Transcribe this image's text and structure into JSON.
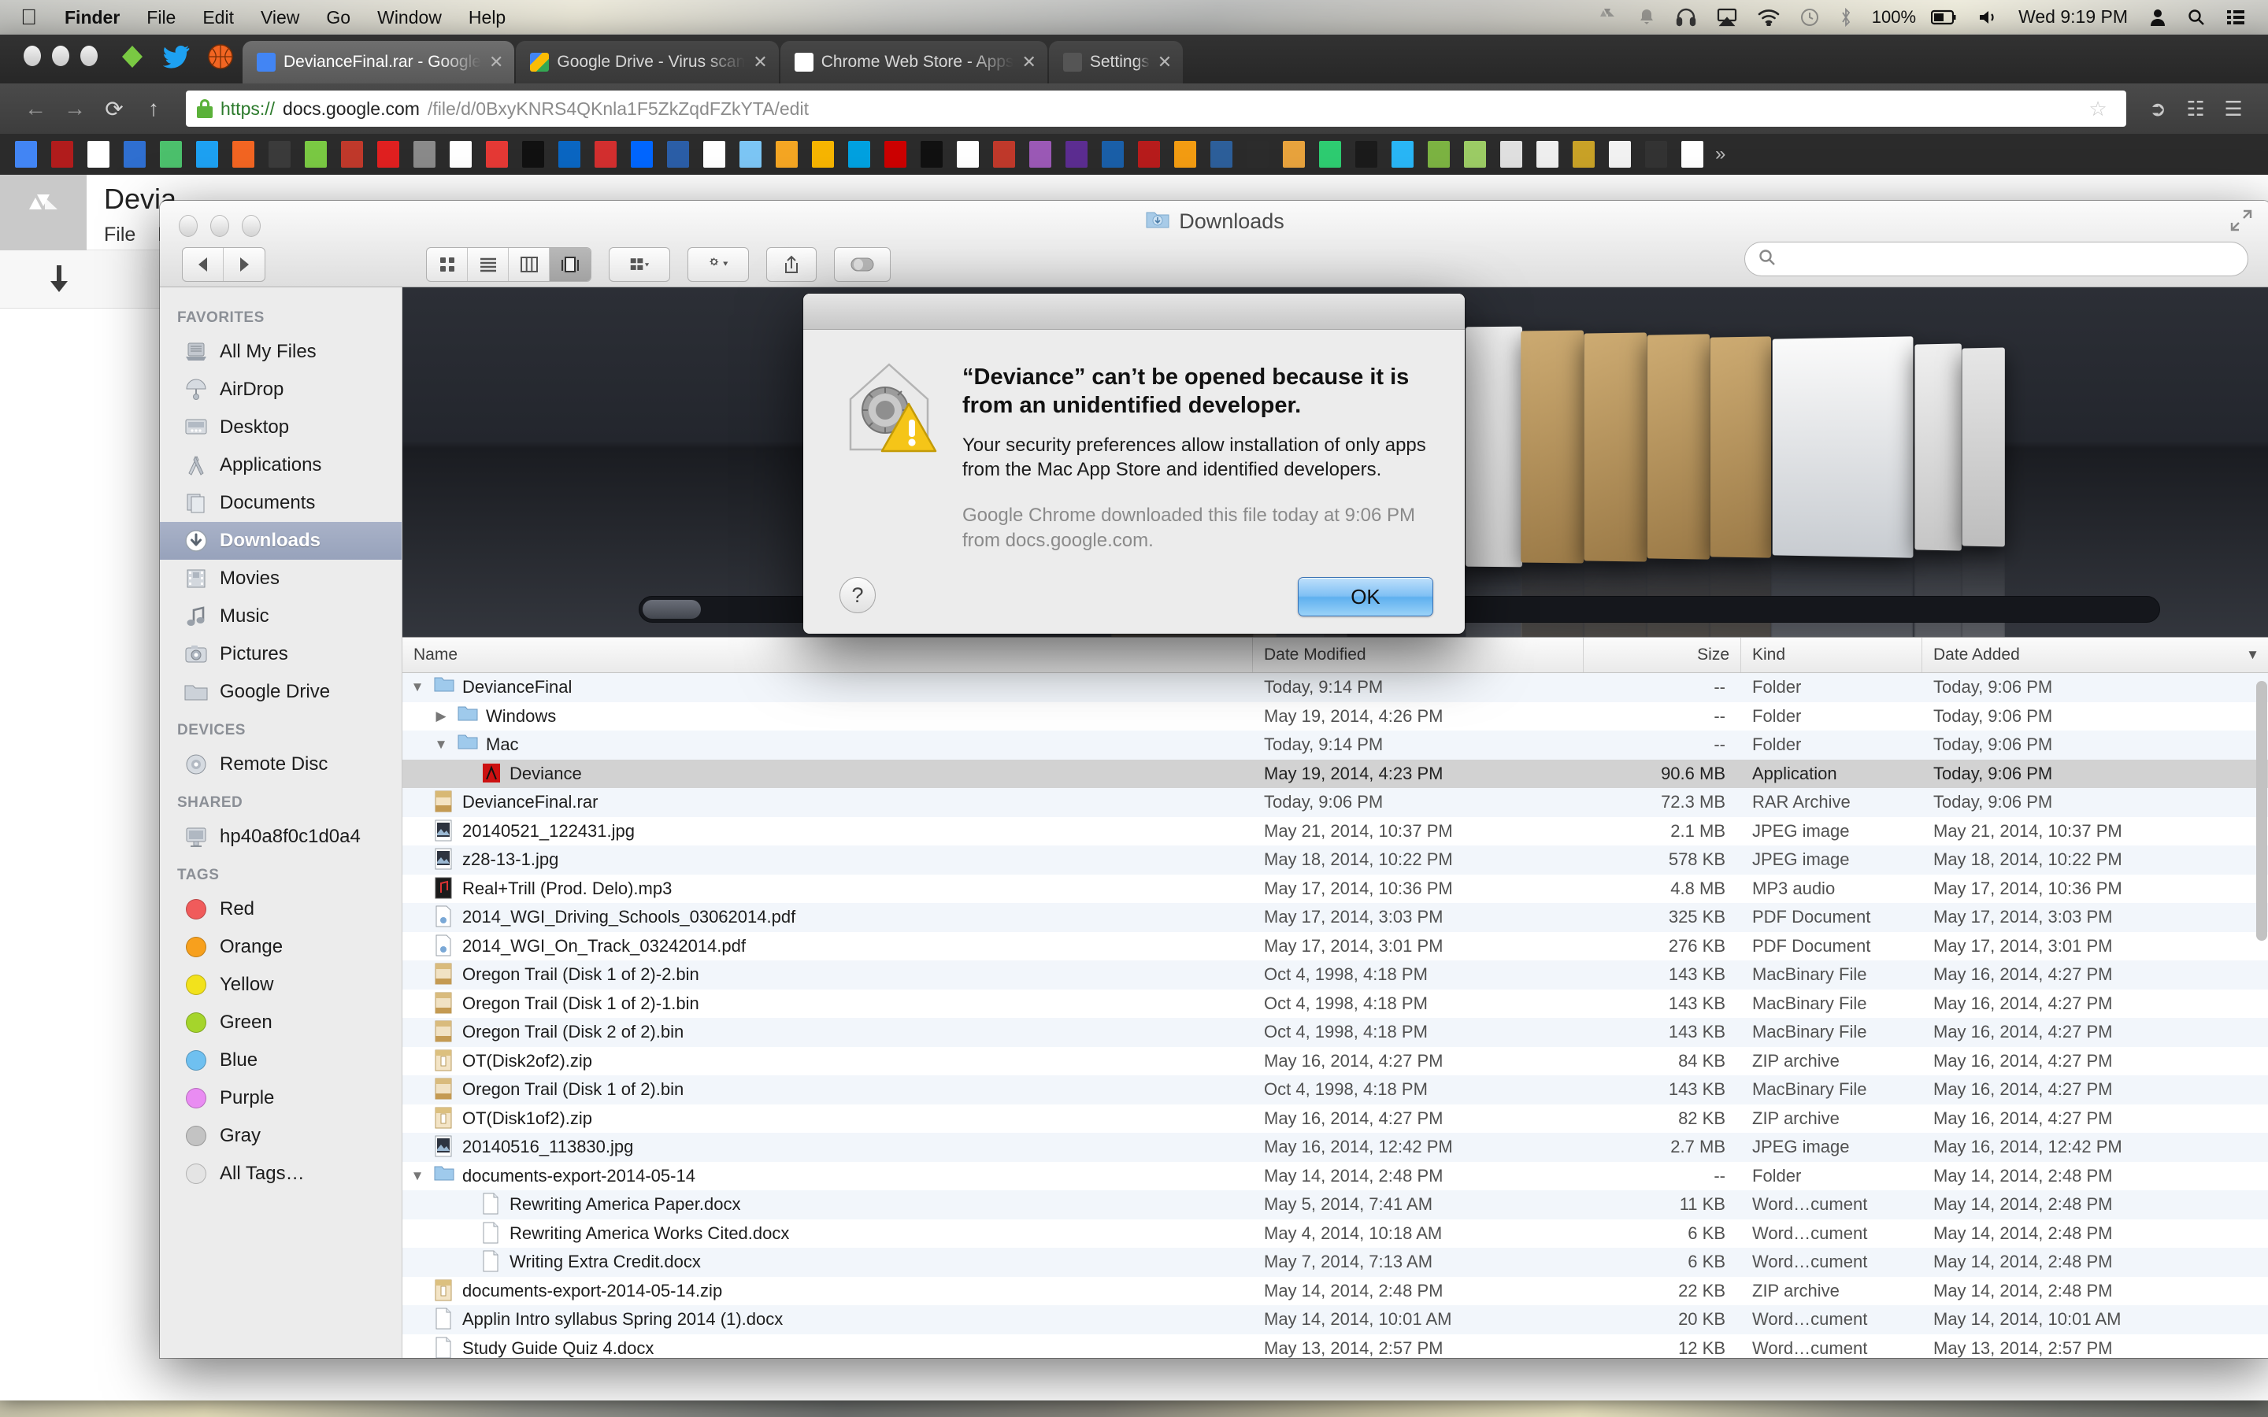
{
  "menubar": {
    "apple": "apple-logo",
    "items": [
      "Finder",
      "File",
      "Edit",
      "View",
      "Go",
      "Window",
      "Help"
    ],
    "status_icons": [
      "google-drive-icon",
      "bell-icon",
      "headphones-icon",
      "airplay-icon",
      "wifi-icon",
      "time-machine-icon",
      "bluetooth-icon"
    ],
    "battery_percent": "100%",
    "clock": "Wed 9:19 PM",
    "right_icons": [
      "user-icon",
      "spotlight-search-icon",
      "notification-center-icon"
    ]
  },
  "browser": {
    "tabs": [
      {
        "label": "DevianceFinal.rar - Google",
        "favicon": "#4285f4",
        "active": true,
        "close": "✕"
      },
      {
        "label": "Google Drive - Virus scan",
        "favicon": "#fbbc05",
        "active": false,
        "close": "✕"
      },
      {
        "label": "Chrome Web Store - Apps",
        "favicon": "#ffffff",
        "active": false,
        "close": "✕"
      },
      {
        "label": "Settings",
        "favicon": "#d8d8d8",
        "active": false,
        "close": "✕"
      }
    ],
    "nav": {
      "back": "←",
      "forward": "→",
      "reload": "⟳",
      "home": "↑"
    },
    "url": {
      "scheme": "https://",
      "host": "docs.google.com",
      "path": "/file/d/0BxyKNRS4QKnla1F5ZkZqdFZkYTA/edit",
      "full": "https://docs.google.com/file/d/0BxyKNRS4QKnla1F5ZkZqdFZkYTA/edit"
    },
    "omni_icons": [
      "bookmark-star-icon",
      "extension-icon",
      "apps-icon",
      "chrome-menu-icon"
    ],
    "bookmark_colors": [
      "#4285f4",
      "#b11c1c",
      "#ffffff",
      "#2f6fd0",
      "#4cc06c",
      "#1da1f2",
      "#f26522",
      "#3b3b3b",
      "#7ac943",
      "#c0392b",
      "#e02020",
      "#8a8a8a",
      "#ffffff",
      "#e53935",
      "#111111",
      "#0a66c2",
      "#d32f2f",
      "#0066ff",
      "#2b5ea7",
      "#ffffff",
      "#7cc6f5",
      "#f5a623",
      "#f7b500",
      "#00a1e0",
      "#cc0000",
      "#111111",
      "#ffffff",
      "#c0392b",
      "#9b59b6",
      "#5c2d91",
      "#1a5fa8",
      "#b71c1c",
      "#f39c12",
      "#2d5f9a",
      "#2c2c2c",
      "#e8a33d",
      "#2ecc71",
      "#1b1b1b",
      "#29b6f6",
      "#7cb342",
      "#9ccc65",
      "#e0e0e0",
      "#efefef",
      "#c9a227",
      "#f2f2f2",
      "#333333",
      "#ffffff"
    ],
    "bookmark_overflow": "»"
  },
  "docs_page": {
    "logo": "google-drive-logo",
    "title": "Devia",
    "menus": [
      "File",
      "E"
    ],
    "download_icon": "download-arrow-icon"
  },
  "finder": {
    "window_title": "Downloads",
    "title_icon": "downloads-folder-icon",
    "fullscreen_icon": "fullscreen-icon",
    "toolbar": {
      "back": "◀",
      "forward": "▶",
      "views": [
        {
          "name": "icon-view",
          "selected": false
        },
        {
          "name": "list-view",
          "selected": false
        },
        {
          "name": "column-view",
          "selected": false
        },
        {
          "name": "coverflow-view",
          "selected": true
        }
      ],
      "arrange": "arrange-button",
      "action": "action-gear-button",
      "share": "share-button",
      "tag": "tag-button"
    },
    "search_placeholder": "",
    "sidebar": [
      {
        "header": "FAVORITES",
        "items": [
          {
            "label": "All My Files",
            "icon": "all-my-files-icon",
            "selected": false
          },
          {
            "label": "AirDrop",
            "icon": "airdrop-icon",
            "selected": false
          },
          {
            "label": "Desktop",
            "icon": "desktop-icon",
            "selected": false
          },
          {
            "label": "Applications",
            "icon": "applications-icon",
            "selected": false
          },
          {
            "label": "Documents",
            "icon": "documents-icon",
            "selected": false
          },
          {
            "label": "Downloads",
            "icon": "downloads-icon",
            "selected": true
          },
          {
            "label": "Movies",
            "icon": "movies-icon",
            "selected": false
          },
          {
            "label": "Music",
            "icon": "music-icon",
            "selected": false
          },
          {
            "label": "Pictures",
            "icon": "pictures-icon",
            "selected": false
          },
          {
            "label": "Google Drive",
            "icon": "folder-icon",
            "selected": false
          }
        ]
      },
      {
        "header": "DEVICES",
        "items": [
          {
            "label": "Remote Disc",
            "icon": "disc-icon",
            "selected": false
          }
        ]
      },
      {
        "header": "SHARED",
        "items": [
          {
            "label": "hp40a8f0c1d0a4",
            "icon": "computer-icon",
            "selected": false
          }
        ]
      },
      {
        "header": "TAGS",
        "items": [
          {
            "label": "Red",
            "icon": "tag-dot",
            "color": "#f05b5b",
            "selected": false
          },
          {
            "label": "Orange",
            "icon": "tag-dot",
            "color": "#f7a01d",
            "selected": false
          },
          {
            "label": "Yellow",
            "icon": "tag-dot",
            "color": "#f2e21c",
            "selected": false
          },
          {
            "label": "Green",
            "icon": "tag-dot",
            "color": "#a5d52b",
            "selected": false
          },
          {
            "label": "Blue",
            "icon": "tag-dot",
            "color": "#6fc0f0",
            "selected": false
          },
          {
            "label": "Purple",
            "icon": "tag-dot",
            "color": "#e98cf2",
            "selected": false
          },
          {
            "label": "Gray",
            "icon": "tag-dot",
            "color": "#c3c3c3",
            "selected": false
          },
          {
            "label": "All Tags…",
            "icon": "tag-dot",
            "color": "#e4e4e4",
            "selected": false
          }
        ]
      }
    ],
    "columns": [
      "Name",
      "Date Modified",
      "Size",
      "Kind",
      "Date Added"
    ],
    "sort_indicator": "▼",
    "rows": [
      {
        "name": "DevianceFinal",
        "indent": 0,
        "tri": "▼",
        "icon": "folder-icon",
        "modified": "Today, 9:14 PM",
        "size": "--",
        "kind": "Folder",
        "added": "Today, 9:06 PM",
        "selected": false
      },
      {
        "name": "Windows",
        "indent": 1,
        "tri": "▶",
        "icon": "folder-icon",
        "modified": "May 19, 2014, 4:26 PM",
        "size": "--",
        "kind": "Folder",
        "added": "Today, 9:06 PM",
        "selected": false
      },
      {
        "name": "Mac",
        "indent": 1,
        "tri": "▼",
        "icon": "folder-icon",
        "modified": "Today, 9:14 PM",
        "size": "--",
        "kind": "Folder",
        "added": "Today, 9:06 PM",
        "selected": false
      },
      {
        "name": "Deviance",
        "indent": 2,
        "tri": "",
        "icon": "app-icon",
        "modified": "May 19, 2014, 4:23 PM",
        "size": "90.6 MB",
        "kind": "Application",
        "added": "Today, 9:06 PM",
        "selected": true
      },
      {
        "name": "DevianceFinal.rar",
        "indent": 0,
        "tri": "",
        "icon": "rar-icon",
        "modified": "Today, 9:06 PM",
        "size": "72.3 MB",
        "kind": "RAR Archive",
        "added": "Today, 9:06 PM",
        "selected": false
      },
      {
        "name": "20140521_122431.jpg",
        "indent": 0,
        "tri": "",
        "icon": "jpeg-icon",
        "modified": "May 21, 2014, 10:37 PM",
        "size": "2.1 MB",
        "kind": "JPEG image",
        "added": "May 21, 2014, 10:37 PM",
        "selected": false
      },
      {
        "name": "z28-13-1.jpg",
        "indent": 0,
        "tri": "",
        "icon": "jpeg-icon",
        "modified": "May 18, 2014, 10:22 PM",
        "size": "578 KB",
        "kind": "JPEG image",
        "added": "May 18, 2014, 10:22 PM",
        "selected": false
      },
      {
        "name": "Real+Trill (Prod. Delo).mp3",
        "indent": 0,
        "tri": "",
        "icon": "mp3-icon",
        "modified": "May 17, 2014, 10:36 PM",
        "size": "4.8 MB",
        "kind": "MP3 audio",
        "added": "May 17, 2014, 10:36 PM",
        "selected": false
      },
      {
        "name": "2014_WGI_Driving_Schools_03062014.pdf",
        "indent": 0,
        "tri": "",
        "icon": "pdf-icon",
        "modified": "May 17, 2014, 3:03 PM",
        "size": "325 KB",
        "kind": "PDF Document",
        "added": "May 17, 2014, 3:03 PM",
        "selected": false
      },
      {
        "name": "2014_WGI_On_Track_03242014.pdf",
        "indent": 0,
        "tri": "",
        "icon": "pdf-icon",
        "modified": "May 17, 2014, 3:01 PM",
        "size": "276 KB",
        "kind": "PDF Document",
        "added": "May 17, 2014, 3:01 PM",
        "selected": false
      },
      {
        "name": "Oregon Trail (Disk 1 of 2)-2.bin",
        "indent": 0,
        "tri": "",
        "icon": "bin-icon",
        "modified": "Oct 4, 1998, 4:18 PM",
        "size": "143 KB",
        "kind": "MacBinary File",
        "added": "May 16, 2014, 4:27 PM",
        "selected": false
      },
      {
        "name": "Oregon Trail (Disk 1 of 2)-1.bin",
        "indent": 0,
        "tri": "",
        "icon": "bin-icon",
        "modified": "Oct 4, 1998, 4:18 PM",
        "size": "143 KB",
        "kind": "MacBinary File",
        "added": "May 16, 2014, 4:27 PM",
        "selected": false
      },
      {
        "name": "Oregon Trail (Disk 2 of 2).bin",
        "indent": 0,
        "tri": "",
        "icon": "bin-icon",
        "modified": "Oct 4, 1998, 4:18 PM",
        "size": "143 KB",
        "kind": "MacBinary File",
        "added": "May 16, 2014, 4:27 PM",
        "selected": false
      },
      {
        "name": "OT(Disk2of2).zip",
        "indent": 0,
        "tri": "",
        "icon": "zip-icon",
        "modified": "May 16, 2014, 4:27 PM",
        "size": "84 KB",
        "kind": "ZIP archive",
        "added": "May 16, 2014, 4:27 PM",
        "selected": false
      },
      {
        "name": "Oregon Trail (Disk 1 of 2).bin",
        "indent": 0,
        "tri": "",
        "icon": "bin-icon",
        "modified": "Oct 4, 1998, 4:18 PM",
        "size": "143 KB",
        "kind": "MacBinary File",
        "added": "May 16, 2014, 4:27 PM",
        "selected": false
      },
      {
        "name": "OT(Disk1of2).zip",
        "indent": 0,
        "tri": "",
        "icon": "zip-icon",
        "modified": "May 16, 2014, 4:27 PM",
        "size": "82 KB",
        "kind": "ZIP archive",
        "added": "May 16, 2014, 4:27 PM",
        "selected": false
      },
      {
        "name": "20140516_113830.jpg",
        "indent": 0,
        "tri": "",
        "icon": "jpeg-icon",
        "modified": "May 16, 2014, 12:42 PM",
        "size": "2.7 MB",
        "kind": "JPEG image",
        "added": "May 16, 2014, 12:42 PM",
        "selected": false
      },
      {
        "name": "documents-export-2014-05-14",
        "indent": 0,
        "tri": "▼",
        "icon": "folder-icon",
        "modified": "May 14, 2014, 2:48 PM",
        "size": "--",
        "kind": "Folder",
        "added": "May 14, 2014, 2:48 PM",
        "selected": false
      },
      {
        "name": "Rewriting America Paper.docx",
        "indent": 2,
        "tri": "",
        "icon": "doc-icon",
        "modified": "May 5, 2014, 7:41 AM",
        "size": "11 KB",
        "kind": "Word…cument",
        "added": "May 14, 2014, 2:48 PM",
        "selected": false
      },
      {
        "name": "Rewriting America Works Cited.docx",
        "indent": 2,
        "tri": "",
        "icon": "doc-icon",
        "modified": "May 4, 2014, 10:18 AM",
        "size": "6 KB",
        "kind": "Word…cument",
        "added": "May 14, 2014, 2:48 PM",
        "selected": false
      },
      {
        "name": "Writing Extra Credit.docx",
        "indent": 2,
        "tri": "",
        "icon": "doc-icon",
        "modified": "May 7, 2014, 7:13 AM",
        "size": "6 KB",
        "kind": "Word…cument",
        "added": "May 14, 2014, 2:48 PM",
        "selected": false
      },
      {
        "name": "documents-export-2014-05-14.zip",
        "indent": 0,
        "tri": "",
        "icon": "zip-icon",
        "modified": "May 14, 2014, 2:48 PM",
        "size": "22 KB",
        "kind": "ZIP archive",
        "added": "May 14, 2014, 2:48 PM",
        "selected": false
      },
      {
        "name": "Applin Intro syllabus Spring 2014 (1).docx",
        "indent": 0,
        "tri": "",
        "icon": "doc-icon",
        "modified": "May 14, 2014, 10:01 AM",
        "size": "20 KB",
        "kind": "Word…cument",
        "added": "May 14, 2014, 10:01 AM",
        "selected": false
      },
      {
        "name": "Study Guide Quiz 4.docx",
        "indent": 0,
        "tri": "",
        "icon": "doc-icon",
        "modified": "May 13, 2014, 2:57 PM",
        "size": "12 KB",
        "kind": "Word…cument",
        "added": "May 13, 2014, 2:57 PM",
        "selected": false
      }
    ]
  },
  "dialog": {
    "icon": "gatekeeper-warning-icon",
    "headline": "“Deviance” can’t be opened because it is from an unidentified developer.",
    "body": "Your security preferences allow installation of only apps from the Mac App Store and identified developers.",
    "source": "Google Chrome downloaded this file today at 9:06 PM from docs.google.com.",
    "help_label": "?",
    "ok_label": "OK"
  }
}
